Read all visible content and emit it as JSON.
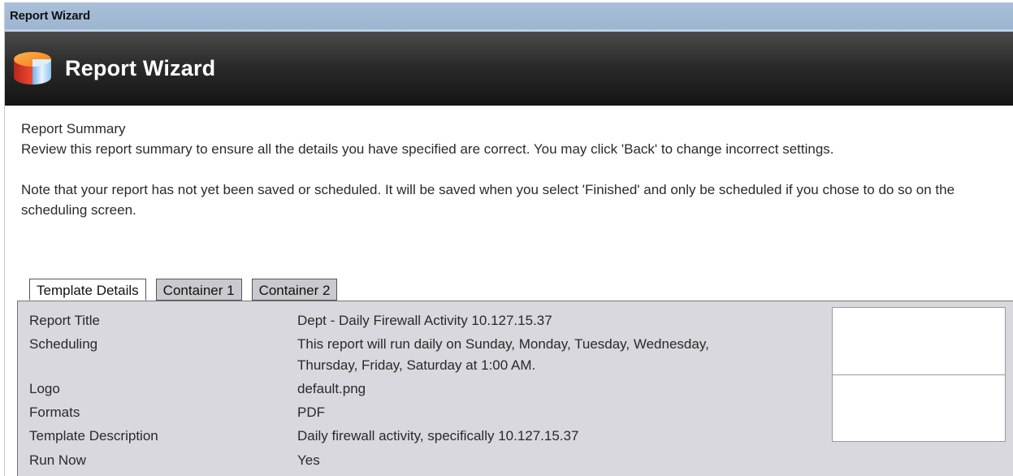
{
  "window": {
    "title": "Report Wizard"
  },
  "banner": {
    "title": "Report Wizard",
    "icon": "report-cylinder-icon"
  },
  "summary": {
    "heading": "Report Summary",
    "review_text": "Review this report summary to ensure all the details you have specified are correct. You may click 'Back' to change incorrect settings.",
    "note_text": "Note that your report has not yet been saved or scheduled. It will be saved when you select 'Finished' and only be scheduled if you chose to do so on the scheduling screen."
  },
  "tabs": [
    {
      "label": "Template Details",
      "active": true
    },
    {
      "label": "Container 1",
      "active": false
    },
    {
      "label": "Container 2",
      "active": false
    }
  ],
  "details": {
    "report_title": {
      "label": "Report Title",
      "value": "Dept - Daily Firewall Activity 10.127.15.37"
    },
    "scheduling": {
      "label": "Scheduling",
      "value_line1": "This report will run daily on Sunday, Monday, Tuesday, Wednesday,",
      "value_line2": "Thursday, Friday, Saturday at 1:00 AM."
    },
    "logo": {
      "label": "Logo",
      "value": "default.png"
    },
    "formats": {
      "label": "Formats",
      "value": "PDF"
    },
    "template_description": {
      "label": "Template Description",
      "value": "Daily firewall activity, specifically 10.127.15.37"
    },
    "run_now": {
      "label": "Run Now",
      "value": "Yes"
    }
  }
}
